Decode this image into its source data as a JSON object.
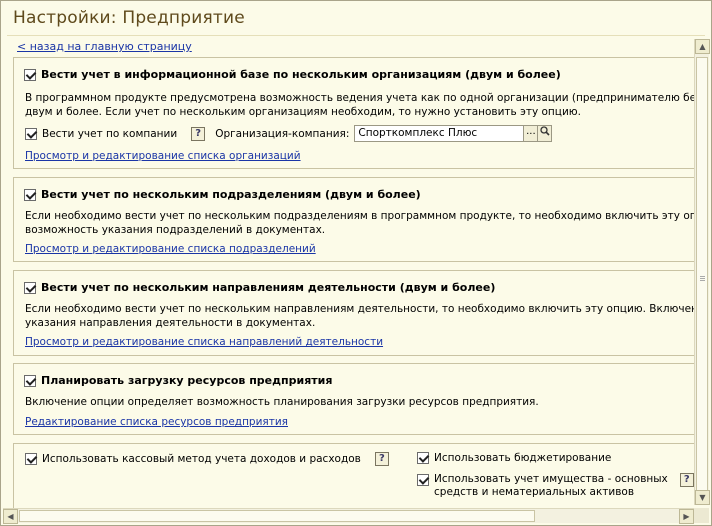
{
  "window": {
    "title": "Настройки: Предприятие",
    "back_link": "< назад на главную страницу"
  },
  "groups": {
    "orgs": {
      "heading": "Вести учет в информационной базе по нескольким организациям (двум и более)",
      "desc_line1": "В программном продукте предусмотрена возможность ведения учета как по одной организации (предпринимателю без образова",
      "desc_line2": "двум и более. Если учет по нескольким организациям необходим, то нужно установить эту опцию.",
      "company_checkbox": "Вести учет по компании",
      "help": "?",
      "company_label": "Организация-компания:",
      "company_value": "Спорткомплекс Плюс",
      "select_btn": "...",
      "link": "Просмотр и редактирование списка организаций"
    },
    "divisions": {
      "heading": "Вести учет по нескольким подразделениям (двум и более)",
      "desc_line1": "Если необходимо вести учет по нескольким подразделениям в программном продукте, то необходимо включить эту опцию. Включ",
      "desc_line2": "возможность указания подразделений в документах.",
      "link": "Просмотр и редактирование списка подразделений"
    },
    "directions": {
      "heading": "Вести учет по нескольким направлениям деятельности (двум и более)",
      "desc_line1": "Если необходимо вести учет по нескольким направлениям деятельности, то необходимо включить эту опцию. Включение этой опци",
      "desc_line2": "указания направления деятельности в документах.",
      "link": "Просмотр и редактирование списка направлений деятельности"
    },
    "resources": {
      "heading": "Планировать загрузку ресурсов предприятия",
      "desc_line1": "Включение опции определяет возможность планирования загрузки ресурсов предприятия.",
      "link": "Редактирование списка ресурсов предприятия"
    },
    "misc": {
      "cash_method": "Использовать кассовый метод учета доходов и расходов",
      "budgeting": "Использовать бюджетирование",
      "property_line1": "Использовать учет имущества - основных",
      "property_line2": "средств и нематериальных активов",
      "help": "?"
    }
  },
  "scroll": {
    "up": "▲",
    "down": "▼",
    "left": "◀",
    "right": "▶"
  }
}
